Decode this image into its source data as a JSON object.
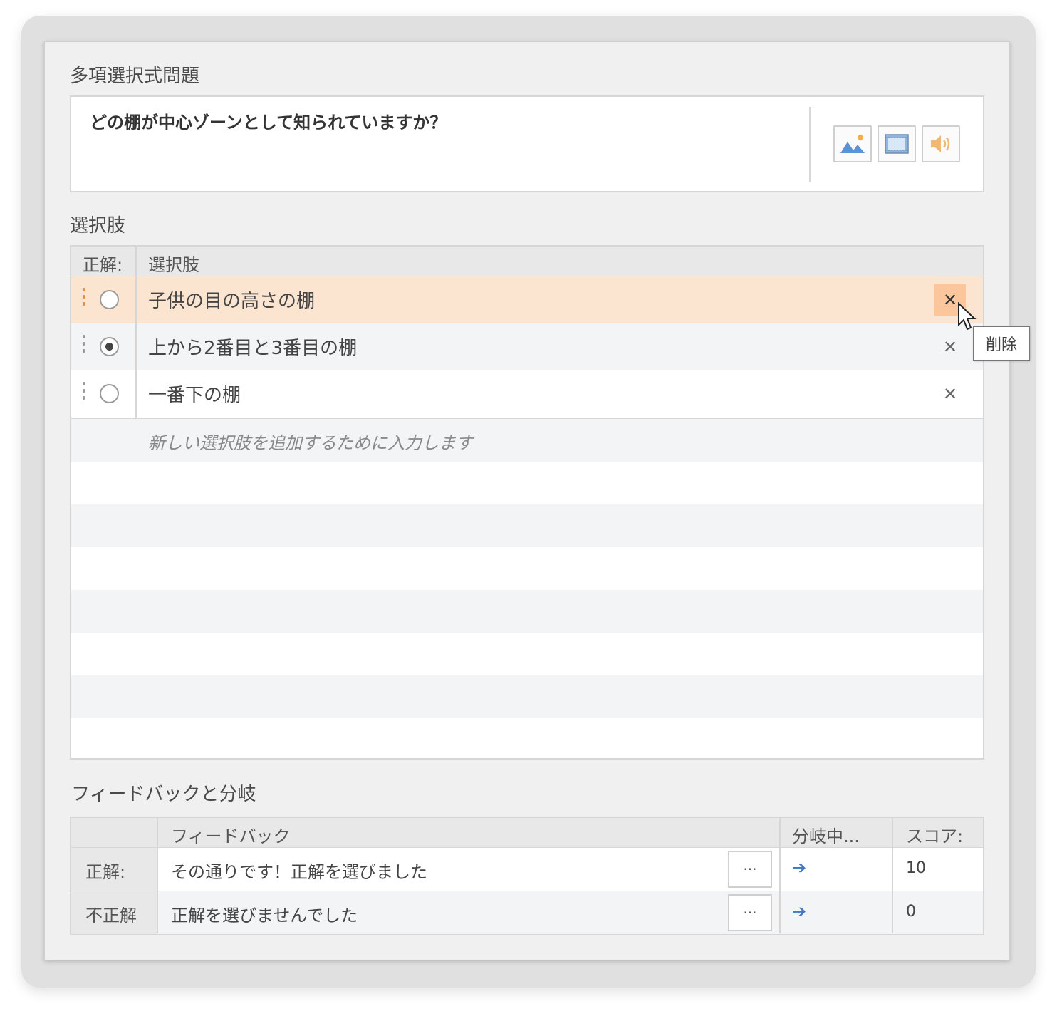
{
  "question_section": {
    "title": "多項選択式問題",
    "question_text": "どの棚が中心ゾーンとして知られていますか？",
    "media_buttons": [
      "image-icon",
      "video-icon",
      "audio-icon"
    ]
  },
  "choices_section": {
    "title": "選択肢",
    "headers": {
      "correct": "正解:",
      "choice": "選択肢"
    },
    "items": [
      {
        "label": "子供の目の高さの棚",
        "correct": false,
        "hover": true
      },
      {
        "label": "上から2番目と3番目の棚",
        "correct": true,
        "hover": false
      },
      {
        "label": "一番下の棚",
        "correct": false,
        "hover": false
      }
    ],
    "delete_symbol": "✕",
    "add_placeholder": "新しい選択肢を追加するために入力します",
    "tooltip": "削除"
  },
  "feedback_section": {
    "title": "フィードバックと分岐",
    "headers": {
      "feedback": "フィードバック",
      "branch": "分岐中...",
      "score": "スコア:"
    },
    "rows": [
      {
        "label": "正解:",
        "feedback": "その通りです！正解を選びました",
        "more": "···",
        "branch_icon": "arrow-right-icon",
        "score": "10"
      },
      {
        "label": "不正解",
        "feedback": "正解を選びませんでした",
        "more": "···",
        "branch_icon": "arrow-right-icon",
        "score": "0"
      }
    ]
  },
  "colors": {
    "hover_row": "#fbe4d0",
    "delete_hover": "#fbc69b",
    "branch_arrow": "#3f78c4",
    "stripe": "#f3f4f6"
  }
}
